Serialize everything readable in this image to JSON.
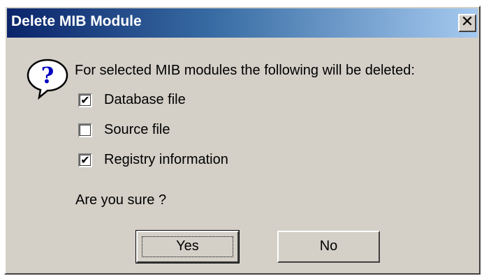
{
  "dialog": {
    "title": "Delete MIB Module",
    "close_glyph": "✕",
    "icon": "question-mark-icon",
    "message": "For selected MIB modules the following will be deleted:",
    "options": [
      {
        "label": "Database file",
        "checked": true
      },
      {
        "label": "Source file",
        "checked": false
      },
      {
        "label": "Registry information",
        "checked": true
      }
    ],
    "confirm_text": "Are you sure ?",
    "buttons": {
      "yes": "Yes",
      "no": "No"
    }
  },
  "colors": {
    "title_gradient_start": "#0a246a",
    "title_gradient_end": "#a6caf0",
    "face": "#d4d0c8"
  }
}
